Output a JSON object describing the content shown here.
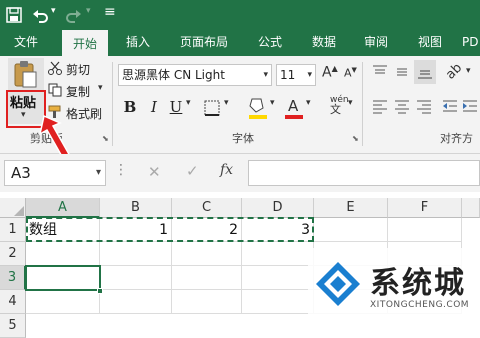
{
  "tabs": [
    "文件",
    "开始",
    "插入",
    "页面布局",
    "公式",
    "数据",
    "审阅",
    "视图",
    "PD"
  ],
  "clipboard": {
    "paste_label": "粘贴",
    "cut_label": "剪切",
    "copy_label": "复制",
    "format_painter_label": "格式刷",
    "group_label": "剪贴板"
  },
  "font": {
    "name": "思源黑体 CN Light",
    "size": "11",
    "group_label": "字体"
  },
  "align": {
    "group_label": "对齐方"
  },
  "name_box": "A3",
  "fx_label": "fx",
  "columns": [
    "A",
    "B",
    "C",
    "D",
    "E",
    "F"
  ],
  "rows": [
    "1",
    "2",
    "3",
    "4",
    "5"
  ],
  "cells": {
    "A1": "数组",
    "B1": "1",
    "C1": "2",
    "D1": "3"
  },
  "watermark": {
    "name": "系统城",
    "url": "XITONGCHENG.COM"
  },
  "colors": {
    "accent": "#217346",
    "highlight": "#e8e8e8",
    "annotation": "#e02020"
  }
}
